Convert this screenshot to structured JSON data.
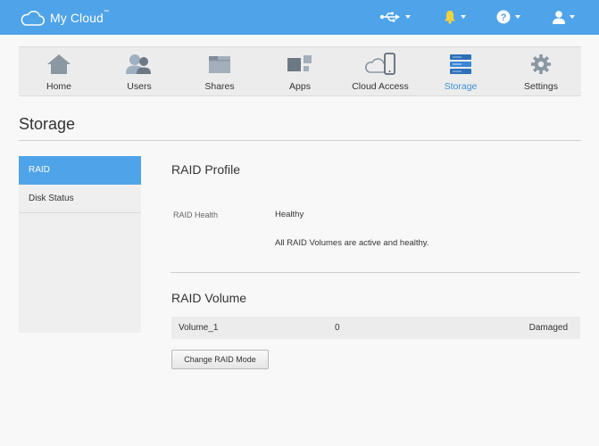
{
  "header": {
    "app_name": "My Cloud",
    "trademark": "™",
    "icons": [
      "cloud-logo-icon",
      "usb-icon",
      "bell-icon",
      "help-icon",
      "user-icon"
    ],
    "colors": {
      "bar": "#4fa3e8",
      "bell": "#f5d33c"
    }
  },
  "nav": {
    "items": [
      {
        "label": "Home",
        "icon": "home-icon"
      },
      {
        "label": "Users",
        "icon": "users-icon"
      },
      {
        "label": "Shares",
        "icon": "folder-icon"
      },
      {
        "label": "Apps",
        "icon": "apps-icon"
      },
      {
        "label": "Cloud Access",
        "icon": "cloud-access-icon"
      },
      {
        "label": "Storage",
        "icon": "storage-icon",
        "active": true
      },
      {
        "label": "Settings",
        "icon": "gear-icon"
      }
    ],
    "active_color": "#3d8fd8"
  },
  "page": {
    "title": "Storage"
  },
  "sidebar": {
    "items": [
      {
        "label": "RAID",
        "active": true
      },
      {
        "label": "Disk Status"
      }
    ]
  },
  "raid_profile": {
    "heading": "RAID Profile",
    "health_label": "RAID Health",
    "health_value": "Healthy",
    "message": "All RAID Volumes are active and healthy."
  },
  "raid_volume": {
    "heading": "RAID Volume",
    "rows": [
      {
        "name": "Volume_1",
        "value": "0",
        "status": "Damaged"
      }
    ],
    "button_label": "Change RAID Mode"
  }
}
